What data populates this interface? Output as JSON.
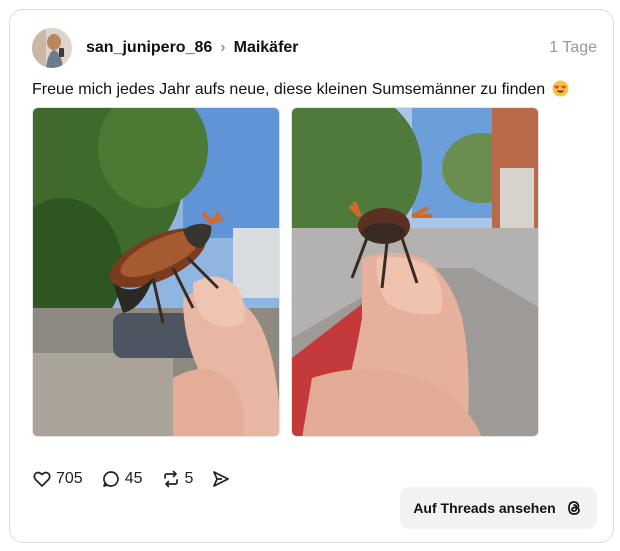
{
  "post": {
    "username": "san_junipero_86",
    "topic": "Maikäfer",
    "time": "1 Tage",
    "caption": "Freue mich jedes Jahr aufs neue, diese kleinen Sumsemänner zu finden",
    "emoji": "smiling-face-with-heart-eyes"
  },
  "stats": {
    "likes": "705",
    "replies": "45",
    "reposts": "5"
  },
  "footer": {
    "button_label": "Auf Threads ansehen"
  },
  "icons": {
    "like": "heart-icon",
    "reply": "comment-icon",
    "repost": "repost-icon",
    "share": "send-icon",
    "threads": "threads-logo-icon"
  }
}
